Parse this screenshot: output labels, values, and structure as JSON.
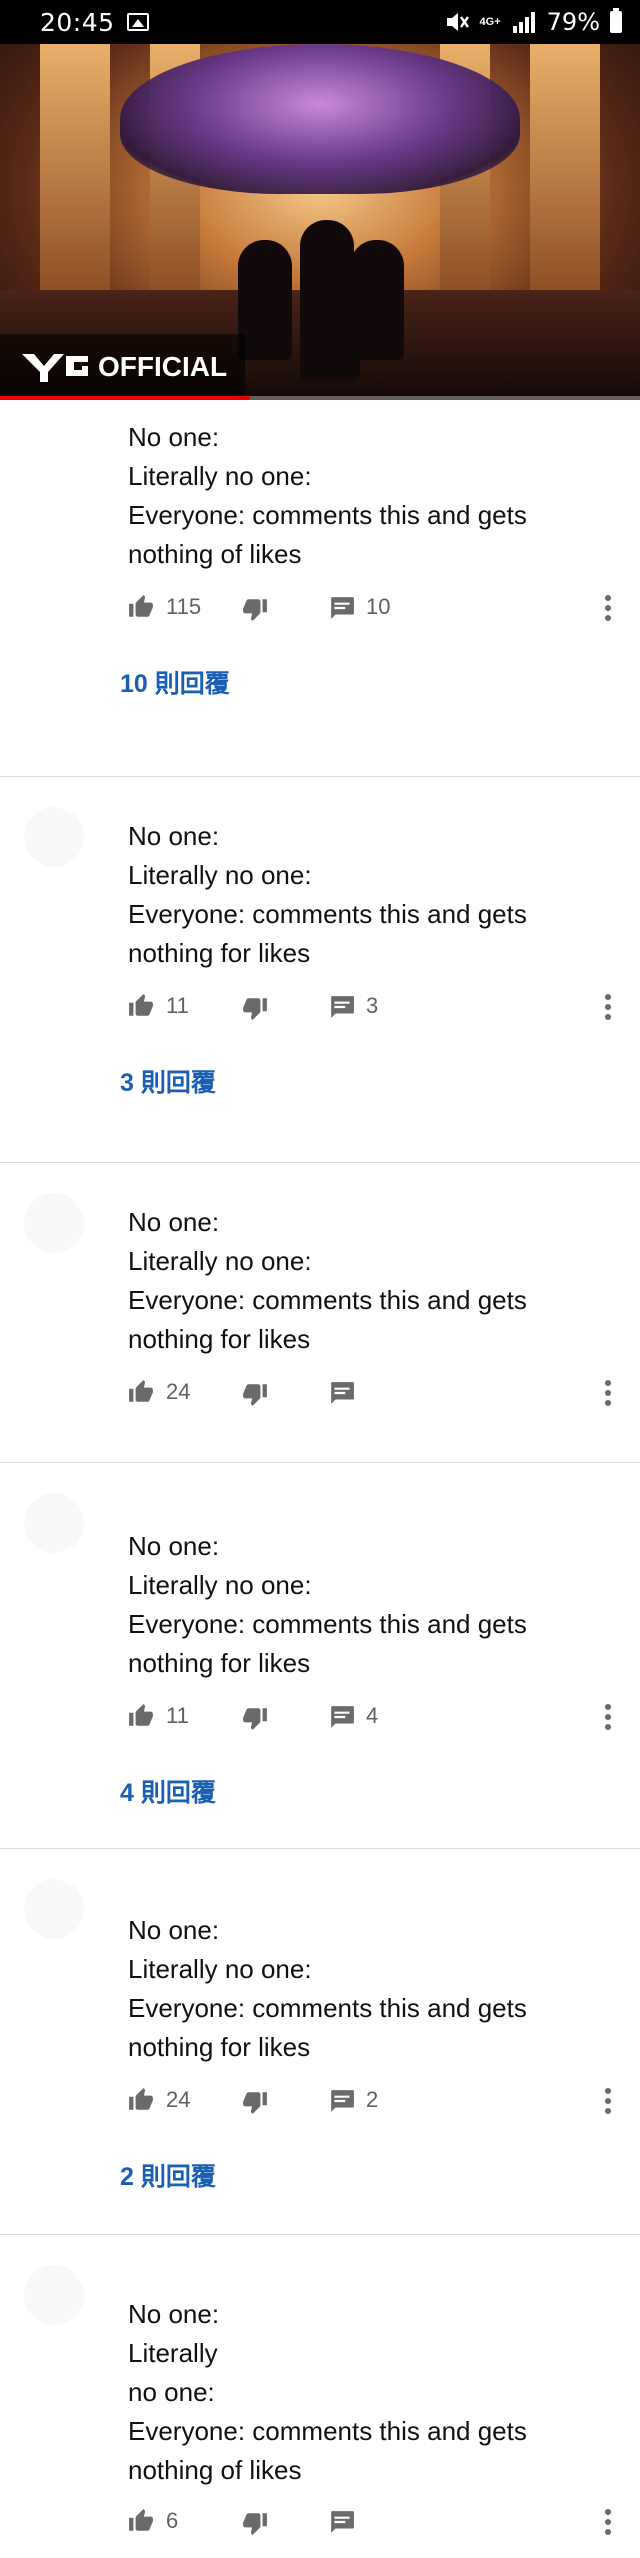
{
  "status_bar": {
    "time": "20:45",
    "network": "4G+",
    "battery": "79%"
  },
  "video": {
    "channel_logo_text": "OFFICIAL",
    "playback_progress_percent": 39
  },
  "icons": {
    "like": "thumb-up-icon",
    "dislike": "thumb-down-icon",
    "reply": "comment-bubble-icon",
    "more": "more-vert-icon"
  },
  "colors": {
    "link": "#1a5fb4",
    "progress": "#ee0000"
  },
  "comments": [
    {
      "lines": [
        "No one:",
        "Literally no one:",
        "Everyone: comments this and gets",
        "nothing of likes"
      ],
      "likes": "115",
      "replies": "10",
      "replies_link": "10 則回覆"
    },
    {
      "lines": [
        "No one:",
        "Literally no one:",
        "Everyone: comments this and gets",
        "nothing for likes"
      ],
      "likes": "11",
      "replies": "3",
      "replies_link": "3 則回覆"
    },
    {
      "lines": [
        "No one:",
        "Literally no one:",
        "Everyone: comments this and gets",
        "nothing for likes"
      ],
      "likes": "24",
      "replies": "",
      "replies_link": ""
    },
    {
      "lines": [
        "No one:",
        "Literally no one:",
        "Everyone: comments this and gets",
        "nothing for likes"
      ],
      "likes": "11",
      "replies": "4",
      "replies_link": "4 則回覆"
    },
    {
      "lines": [
        "No one:",
        "Literally no one:",
        "Everyone: comments this and gets",
        "nothing for likes"
      ],
      "likes": "24",
      "replies": "2",
      "replies_link": "2 則回覆"
    },
    {
      "lines": [
        "No one:",
        "Literally",
        "no one:",
        "Everyone: comments this and gets",
        "nothing of likes"
      ],
      "likes": "6",
      "replies": "",
      "replies_link": ""
    }
  ]
}
